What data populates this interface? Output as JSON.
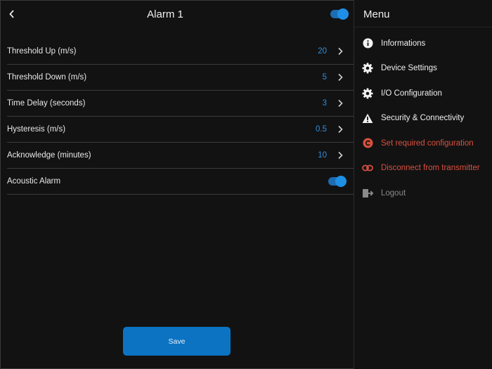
{
  "header": {
    "title": "Alarm 1",
    "enabled": true
  },
  "settings": [
    {
      "label": "Threshold Up (m/s)",
      "value": "20"
    },
    {
      "label": "Threshold Down (m/s)",
      "value": "5"
    },
    {
      "label": "Time Delay (seconds)",
      "value": "3"
    },
    {
      "label": "Hysteresis (m/s)",
      "value": "0.5"
    },
    {
      "label": "Acknowledge (minutes)",
      "value": "10"
    }
  ],
  "acoustic": {
    "label": "Acoustic Alarm",
    "enabled": true
  },
  "save_label": "Save",
  "menu": {
    "title": "Menu",
    "items": [
      {
        "label": "Informations",
        "icon": "info-icon",
        "color": "#efefef"
      },
      {
        "label": "Device Settings",
        "icon": "gear-icon",
        "color": "#efefef"
      },
      {
        "label": "I/O Configuration",
        "icon": "gear-icon",
        "color": "#efefef"
      },
      {
        "label": "Security & Connectivity",
        "icon": "warning-icon",
        "color": "#efefef"
      },
      {
        "label": "Set required configuration",
        "icon": "alert-circle-icon",
        "color": "#d9503f"
      },
      {
        "label": "Disconnect from transmitter",
        "icon": "link-icon",
        "color": "#d9503f"
      },
      {
        "label": "Logout",
        "icon": "logout-icon",
        "color": "#8a8a8a"
      }
    ]
  },
  "colors": {
    "accent": "#0b73c2",
    "value_text": "#2f8ddc",
    "danger": "#d9503f",
    "background": "#121212"
  }
}
